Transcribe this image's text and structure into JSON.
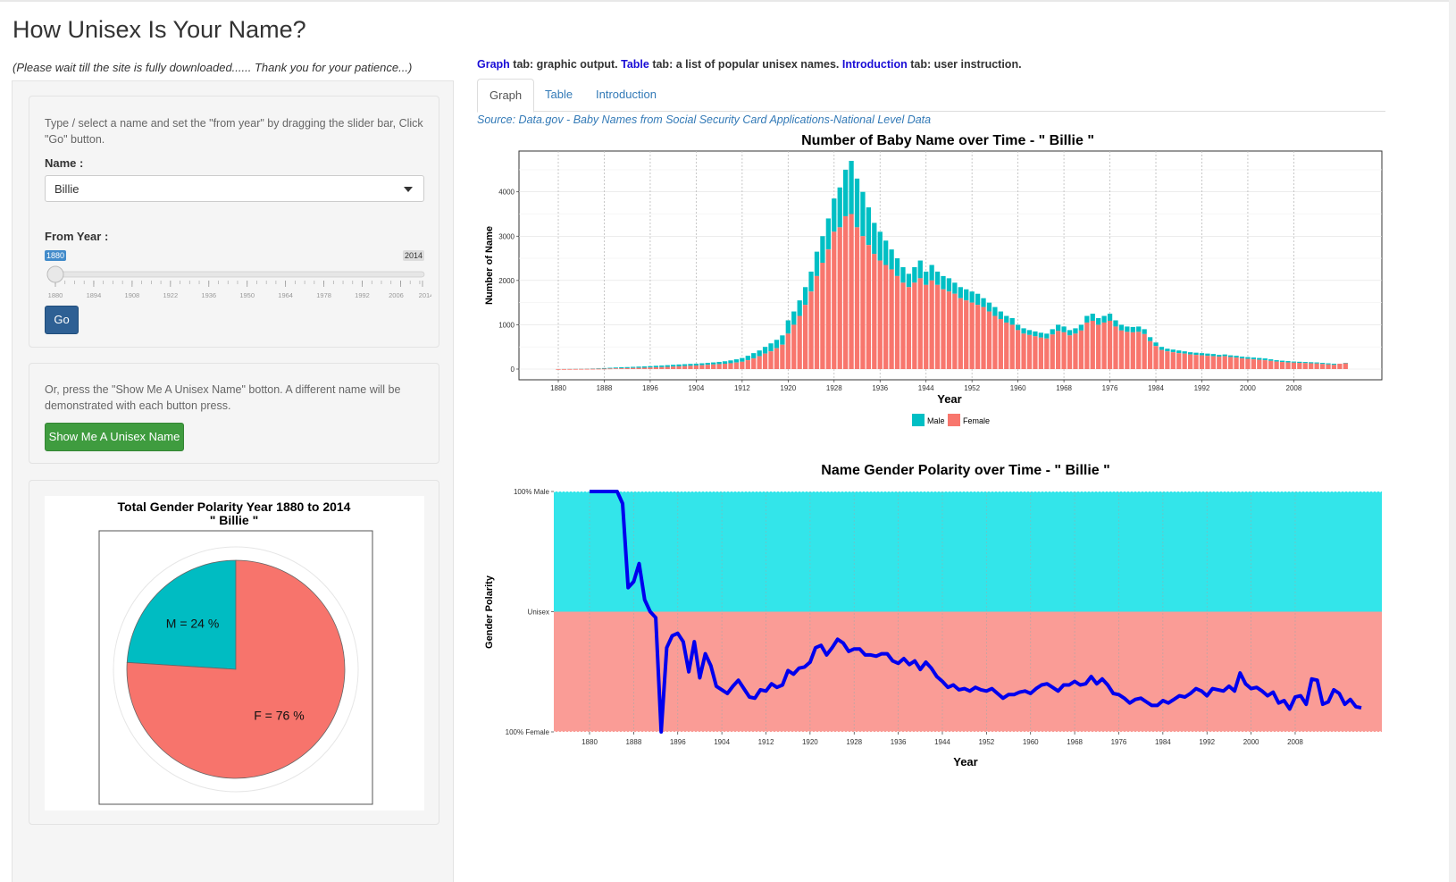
{
  "page": {
    "title": "How Unisex Is Your Name?",
    "subtitle": "(Please wait till the site is fully downloaded...... Thank you for your patience...)"
  },
  "sidebar": {
    "instructions": "Type / select a name and set the \"from year\" by dragging the slider bar, Click \"Go\" button.",
    "name_label": "Name :",
    "name_value": "Billie",
    "from_year_label": "From Year :",
    "slider": {
      "min": 1880,
      "max": 2014,
      "value": 1880,
      "min_label": "1880",
      "value_label": "1880",
      "max_label": "2014",
      "ticks": [
        "1880",
        "1894",
        "1908",
        "1922",
        "1936",
        "1950",
        "1964",
        "1978",
        "1992",
        "2006",
        "2014"
      ]
    },
    "go_label": "Go",
    "random_instructions": "Or, press the \"Show Me A Unisex Name\" botton. A different name will be demonstrated with each button press.",
    "random_button": "Show Me A Unisex Name",
    "colors": {
      "primary": "#2e6094",
      "success": "#3f9c3f"
    }
  },
  "main": {
    "instr_graph": "Graph",
    "instr_graph_text": " tab: graphic output. ",
    "instr_table": "Table",
    "instr_table_text": " tab: a list of popular unisex names. ",
    "instr_intro": "Introduction",
    "instr_intro_text": " tab: user instruction.",
    "tabs": [
      {
        "label": "Graph",
        "active": true
      },
      {
        "label": "Table",
        "active": false
      },
      {
        "label": "Introduction",
        "active": false
      }
    ],
    "source": "Source: Data.gov - Baby Names from Social Security Card Applications-National Level Data"
  },
  "chart_data": [
    {
      "type": "bar",
      "stacked": true,
      "title": "Number of Baby Name over Time - \" Billie \"",
      "xlabel": "Year",
      "ylabel": "Number of Name",
      "xlim": [
        1880,
        2014
      ],
      "ylim": [
        0,
        4700
      ],
      "xticks": [
        1880,
        1888,
        1896,
        1904,
        1912,
        1920,
        1928,
        1936,
        1944,
        1952,
        1960,
        1968,
        1976,
        1984,
        1992,
        2000,
        2008
      ],
      "yticks": [
        0,
        1000,
        2000,
        3000,
        4000
      ],
      "legend": "bottom",
      "colors": {
        "Male": "#00bfc4",
        "Female": "#f8766d"
      },
      "series_names": [
        "Male",
        "Female"
      ],
      "start_year": 1880,
      "total": [
        2,
        3,
        5,
        7,
        9,
        11,
        14,
        18,
        23,
        29,
        35,
        40,
        45,
        50,
        55,
        60,
        66,
        74,
        80,
        88,
        96,
        104,
        110,
        116,
        122,
        130,
        140,
        150,
        162,
        176,
        196,
        220,
        250,
        300,
        360,
        420,
        500,
        580,
        660,
        760,
        1100,
        1300,
        1550,
        1850,
        2200,
        2650,
        3000,
        3400,
        3850,
        4100,
        4500,
        4700,
        4300,
        4000,
        3650,
        3300,
        3100,
        2900,
        2700,
        2500,
        2300,
        2150,
        2300,
        2450,
        2200,
        2350,
        2200,
        2100,
        2050,
        1950,
        1850,
        1800,
        1750,
        1700,
        1600,
        1500,
        1400,
        1300,
        1200,
        1150,
        1000,
        920,
        880,
        850,
        820,
        800,
        900,
        1000,
        960,
        880,
        920,
        1000,
        1200,
        1250,
        1150,
        1200,
        1250,
        1100,
        1000,
        960,
        950,
        960,
        900,
        720,
        600,
        500,
        460,
        440,
        420,
        400,
        380,
        370,
        360,
        350,
        340,
        320,
        330,
        310,
        300,
        280,
        270,
        260,
        250,
        240,
        220,
        200,
        190,
        180,
        170,
        165,
        160,
        155,
        150,
        140,
        130,
        120,
        110,
        140,
        150
      ],
      "female": [
        1,
        1,
        2,
        3,
        4,
        5,
        6,
        8,
        10,
        13,
        16,
        19,
        22,
        25,
        28,
        31,
        35,
        40,
        44,
        50,
        56,
        62,
        68,
        74,
        80,
        88,
        96,
        104,
        112,
        120,
        132,
        148,
        165,
        200,
        240,
        290,
        350,
        400,
        470,
        550,
        800,
        1000,
        1200,
        1450,
        1750,
        2100,
        2400,
        2700,
        3100,
        3200,
        3450,
        3500,
        3200,
        3000,
        2800,
        2600,
        2450,
        2350,
        2250,
        2100,
        1950,
        1850,
        1950,
        2050,
        1900,
        2000,
        1900,
        1800,
        1750,
        1700,
        1600,
        1550,
        1500,
        1450,
        1400,
        1300,
        1200,
        1130,
        1050,
        1000,
        880,
        800,
        770,
        740,
        710,
        690,
        780,
        860,
        830,
        760,
        800,
        870,
        1050,
        1090,
        1000,
        1050,
        1090,
        960,
        870,
        840,
        830,
        840,
        790,
        630,
        520,
        430,
        400,
        380,
        360,
        350,
        330,
        320,
        310,
        300,
        290,
        280,
        290,
        270,
        260,
        240,
        230,
        220,
        210,
        200,
        185,
        170,
        160,
        150,
        145,
        140,
        135,
        130,
        125,
        115,
        105,
        95,
        120,
        130
      ]
    },
    {
      "type": "line",
      "title": "Name Gender Polarity over Time - \" Billie \"",
      "xlabel": "Year",
      "ylabel": "Gender Polarity",
      "xlim": [
        1880,
        2014
      ],
      "ylim": [
        -1,
        1
      ],
      "xticks": [
        1880,
        1888,
        1896,
        1904,
        1912,
        1920,
        1928,
        1936,
        1944,
        1952,
        1960,
        1968,
        1976,
        1984,
        1992,
        2000,
        2008
      ],
      "yticks": [
        {
          "value": 1,
          "label": "100% Male"
        },
        {
          "value": 0,
          "label": "Unisex"
        },
        {
          "value": -1,
          "label": "100% Female"
        }
      ],
      "colors": {
        "line": "#0000ee",
        "male_band": "#33e5ea",
        "female_band": "#fa9c96"
      },
      "start_year": 1880,
      "polarity": [
        1,
        1,
        1,
        1,
        1,
        1,
        0.9,
        0.2,
        0.25,
        0.4,
        0.1,
        0,
        -0.05,
        -1,
        -0.3,
        -0.2,
        -0.18,
        -0.25,
        -0.5,
        -0.25,
        -0.55,
        -0.35,
        -0.45,
        -0.62,
        -0.65,
        -0.68,
        -0.62,
        -0.57,
        -0.64,
        -0.71,
        -0.72,
        -0.65,
        -0.66,
        -0.6,
        -0.63,
        -0.61,
        -0.49,
        -0.52,
        -0.47,
        -0.46,
        -0.42,
        -0.3,
        -0.28,
        -0.36,
        -0.3,
        -0.23,
        -0.26,
        -0.33,
        -0.31,
        -0.31,
        -0.36,
        -0.36,
        -0.37,
        -0.35,
        -0.35,
        -0.41,
        -0.43,
        -0.39,
        -0.44,
        -0.41,
        -0.48,
        -0.42,
        -0.47,
        -0.54,
        -0.58,
        -0.63,
        -0.61,
        -0.65,
        -0.64,
        -0.66,
        -0.63,
        -0.65,
        -0.66,
        -0.64,
        -0.68,
        -0.72,
        -0.69,
        -0.69,
        -0.67,
        -0.66,
        -0.68,
        -0.64,
        -0.61,
        -0.6,
        -0.63,
        -0.66,
        -0.61,
        -0.61,
        -0.58,
        -0.61,
        -0.6,
        -0.54,
        -0.6,
        -0.56,
        -0.61,
        -0.68,
        -0.69,
        -0.72,
        -0.76,
        -0.73,
        -0.72,
        -0.75,
        -0.78,
        -0.78,
        -0.74,
        -0.76,
        -0.73,
        -0.7,
        -0.71,
        -0.68,
        -0.64,
        -0.66,
        -0.7,
        -0.64,
        -0.65,
        -0.66,
        -0.62,
        -0.66,
        -0.51,
        -0.6,
        -0.64,
        -0.63,
        -0.66,
        -0.7,
        -0.67,
        -0.76,
        -0.74,
        -0.81,
        -0.71,
        -0.7,
        -0.77,
        -0.56,
        -0.57,
        -0.77,
        -0.75,
        -0.65,
        -0.68,
        -0.77,
        -0.73,
        -0.79,
        -0.8
      ]
    },
    {
      "type": "pie",
      "title": "Total Gender Polarity Year 1880 to 2014",
      "subtitle": "\" Billie \"",
      "slices": [
        {
          "label": "M = 24 %",
          "value": 24,
          "color": "#00bcc2"
        },
        {
          "label": "F = 76 %",
          "value": 76,
          "color": "#f7746c"
        }
      ]
    }
  ]
}
